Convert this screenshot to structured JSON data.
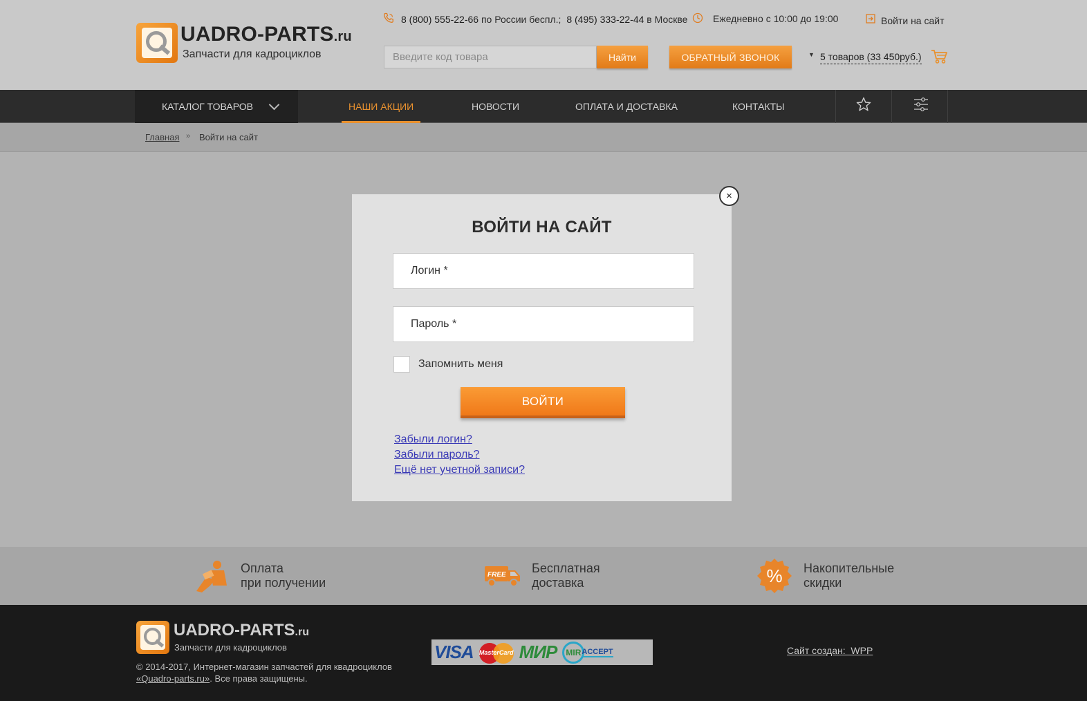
{
  "brand": {
    "name": "UADRO-PARTS",
    "tld": ".ru",
    "tagline": "Запчасти для кадроциклов",
    "accent_color": "#e8912f"
  },
  "header": {
    "phone1": "8 (800) 555-22-66",
    "phone1_note": " по России беспл.; ",
    "phone2": "8 (495) 333-22-44",
    "phone2_note": " в Москве",
    "hours": "Ежедневно с 10:00 до 19:00",
    "login_link": "Войти на сайт",
    "search_placeholder": "Введите код товара",
    "search_button": "Найти",
    "callback_button": "ОБРАТНЫЙ ЗВОНОК",
    "cart_summary": "5 товаров (33 450руб.)"
  },
  "nav": {
    "catalog": "КАТАЛОГ ТОВАРОВ",
    "items": [
      {
        "label": "НАШИ АКЦИИ",
        "active": true
      },
      {
        "label": "НОВОСТИ",
        "active": false
      },
      {
        "label": "ОПЛАТА И ДОСТАВКА",
        "active": false
      },
      {
        "label": "КОНТАКТЫ",
        "active": false
      }
    ],
    "icons": [
      "star-icon",
      "filter-sliders-icon"
    ]
  },
  "breadcrumb": {
    "home": "Главная",
    "separator": "»",
    "current": "Войти на сайт"
  },
  "modal": {
    "close_label": "×",
    "title": "ВОЙТИ НА САЙТ",
    "login_placeholder": "Логин *",
    "password_placeholder": "Пароль *",
    "remember_label": "Запомнить меня",
    "submit": "ВОЙТИ",
    "links": {
      "forgot_login": "Забыли логин?",
      "forgot_password": "Забыли пароль?",
      "register": "Ещё нет учетной записи?"
    }
  },
  "features": [
    {
      "icon": "cash-payment-icon",
      "text": "Оплата\nпри получении"
    },
    {
      "icon": "free-delivery-truck-icon",
      "text": "Бесплатная\nдоставка",
      "badge": "FREE"
    },
    {
      "icon": "discount-percent-icon",
      "text": "Накопительные\nскидки",
      "badge": "%"
    }
  ],
  "footer": {
    "copyright_line1": "© 2014-2017, Интернет-магазин запчастей для квадроциклов",
    "copyright_site": "«Quadro-parts.ru»",
    "copyright_rest": ". Все права защищены.",
    "payments": {
      "visa": "VISA",
      "mastercard": "MasterCard",
      "mir": "МИР",
      "mir_accept_ring": "MIR",
      "mir_accept_text": "ACCEPT"
    },
    "site_by": "Сайт создан:  WPP"
  }
}
